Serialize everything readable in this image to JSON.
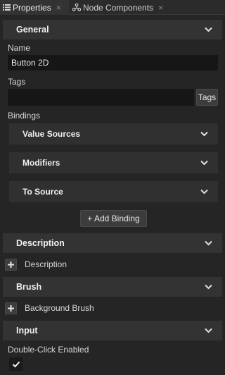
{
  "tabs": [
    {
      "label": "Properties",
      "icon": "list-icon",
      "close": "×",
      "active": true
    },
    {
      "label": "Node Components",
      "icon": "node-icon",
      "close": "×",
      "active": false
    }
  ],
  "sections": {
    "general": {
      "title": "General"
    },
    "description": {
      "title": "Description"
    },
    "brush": {
      "title": "Brush"
    },
    "input": {
      "title": "Input"
    }
  },
  "fields": {
    "name": {
      "label": "Name",
      "value": "Button 2D"
    },
    "tags": {
      "label": "Tags",
      "value": "",
      "button": "Tags"
    }
  },
  "bindings": {
    "label": "Bindings",
    "groups": [
      "Value Sources",
      "Modifiers",
      "To Source"
    ],
    "add_button": "+ Add Binding"
  },
  "description": {
    "add_label": "Description"
  },
  "brush": {
    "add_label": "Background Brush"
  },
  "input": {
    "double_click": {
      "label": "Double-Click Enabled",
      "checked": true
    }
  },
  "colors": {
    "background": "#252526",
    "header": "#333333",
    "field": "#161616",
    "text": "#d6d6d6"
  }
}
